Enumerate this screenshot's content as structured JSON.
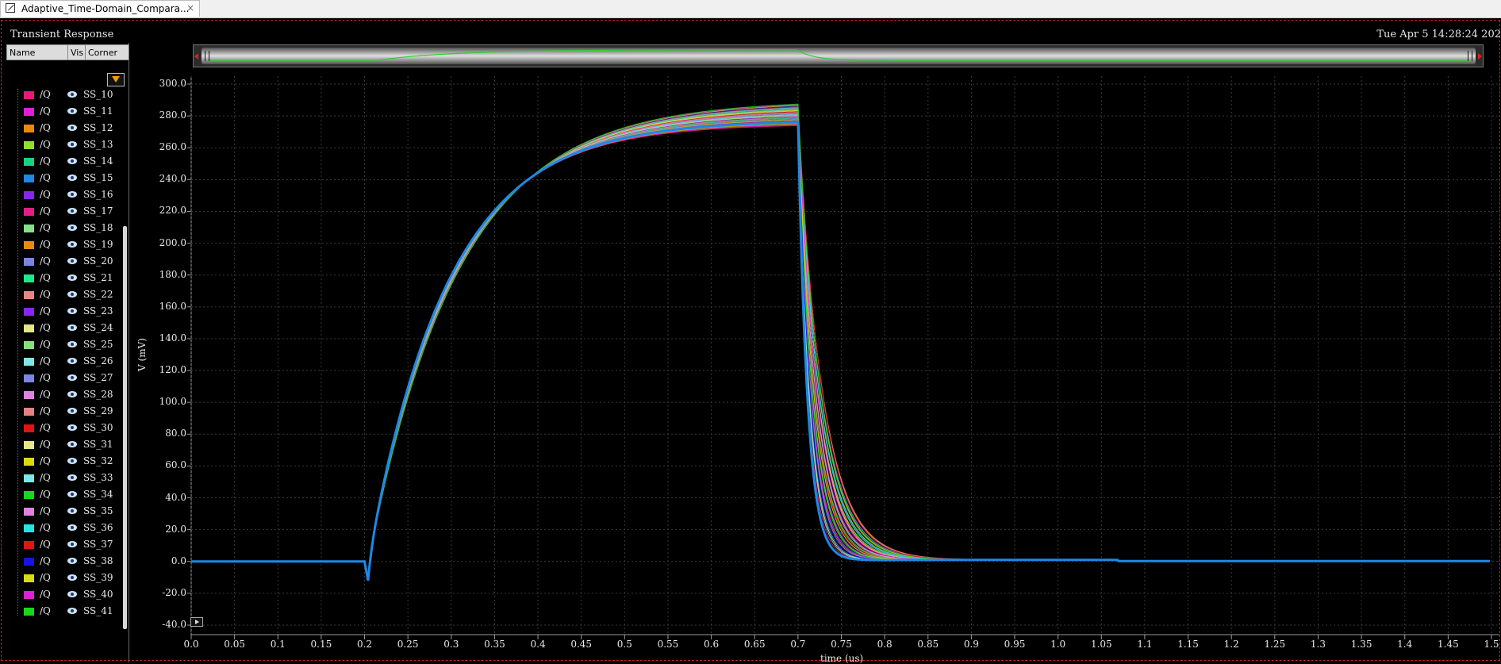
{
  "tab": {
    "title": "Adaptive_Time-Domain_Compara...",
    "close": "×"
  },
  "window": {
    "title": "Transient Response",
    "date": "Tue Apr 5 14:28:24 202"
  },
  "legend": {
    "headers": {
      "name": "Name",
      "vis": "Vis",
      "corner": "Corner"
    },
    "items": [
      {
        "signal": "/Q",
        "corner": "SS_10",
        "color": "#e6197a"
      },
      {
        "signal": "/Q",
        "corner": "SS_11",
        "color": "#e01ed6"
      },
      {
        "signal": "/Q",
        "corner": "SS_12",
        "color": "#e98a0e"
      },
      {
        "signal": "/Q",
        "corner": "SS_13",
        "color": "#8ee02a"
      },
      {
        "signal": "/Q",
        "corner": "SS_14",
        "color": "#17d27f"
      },
      {
        "signal": "/Q",
        "corner": "SS_15",
        "color": "#1e88e5"
      },
      {
        "signal": "/Q",
        "corner": "SS_16",
        "color": "#8a24f0"
      },
      {
        "signal": "/Q",
        "corner": "SS_17",
        "color": "#e01f86"
      },
      {
        "signal": "/Q",
        "corner": "SS_18",
        "color": "#86e08a"
      },
      {
        "signal": "/Q",
        "corner": "SS_19",
        "color": "#e88a12"
      },
      {
        "signal": "/Q",
        "corner": "SS_20",
        "color": "#7b83e8"
      },
      {
        "signal": "/Q",
        "corner": "SS_21",
        "color": "#1ee68c"
      },
      {
        "signal": "/Q",
        "corner": "SS_22",
        "color": "#e98484"
      },
      {
        "signal": "/Q",
        "corner": "SS_23",
        "color": "#8a24f0"
      },
      {
        "signal": "/Q",
        "corner": "SS_24",
        "color": "#e4e48a"
      },
      {
        "signal": "/Q",
        "corner": "SS_25",
        "color": "#86e07a"
      },
      {
        "signal": "/Q",
        "corner": "SS_26",
        "color": "#7fe6e6"
      },
      {
        "signal": "/Q",
        "corner": "SS_27",
        "color": "#7b86e0"
      },
      {
        "signal": "/Q",
        "corner": "SS_28",
        "color": "#e082e0"
      },
      {
        "signal": "/Q",
        "corner": "SS_29",
        "color": "#e68080"
      },
      {
        "signal": "/Q",
        "corner": "SS_30",
        "color": "#e01414"
      },
      {
        "signal": "/Q",
        "corner": "SS_31",
        "color": "#e4e48a"
      },
      {
        "signal": "/Q",
        "corner": "SS_32",
        "color": "#dada14"
      },
      {
        "signal": "/Q",
        "corner": "SS_33",
        "color": "#7fe6e6"
      },
      {
        "signal": "/Q",
        "corner": "SS_34",
        "color": "#18d818"
      },
      {
        "signal": "/Q",
        "corner": "SS_35",
        "color": "#e082e0"
      },
      {
        "signal": "/Q",
        "corner": "SS_36",
        "color": "#1ee6e0"
      },
      {
        "signal": "/Q",
        "corner": "SS_37",
        "color": "#e01414"
      },
      {
        "signal": "/Q",
        "corner": "SS_38",
        "color": "#1414e6"
      },
      {
        "signal": "/Q",
        "corner": "SS_39",
        "color": "#dada14"
      },
      {
        "signal": "/Q",
        "corner": "SS_40",
        "color": "#e01ed6"
      },
      {
        "signal": "/Q",
        "corner": "SS_41",
        "color": "#18d818"
      }
    ]
  },
  "chart_data": {
    "type": "line",
    "title": "Transient Response",
    "xlabel": "time (us)",
    "ylabel": "V (mV)",
    "xlim": [
      0.0,
      1.5
    ],
    "ylim": [
      -40.0,
      300.0
    ],
    "grid": true,
    "xticks": [
      "0.0",
      "0.05",
      "0.1",
      "0.15",
      "0.2",
      "0.25",
      "0.3",
      "0.35",
      "0.4",
      "0.45",
      "0.5",
      "0.55",
      "0.6",
      "0.65",
      "0.7",
      "0.75",
      "0.8",
      "0.85",
      "0.9",
      "0.95",
      "1.0",
      "1.05",
      "1.1",
      "1.15",
      "1.2",
      "1.25",
      "1.3",
      "1.35",
      "1.4",
      "1.45",
      "1.5"
    ],
    "yticks": [
      "300.0",
      "280.0",
      "260.0",
      "240.0",
      "220.0",
      "200.0",
      "180.0",
      "160.0",
      "140.0",
      "120.0",
      "100.0",
      "80.0",
      "60.0",
      "40.0",
      "20.0",
      "0.0",
      "-20.0",
      "-40.0"
    ],
    "series_shape": {
      "baseline": 0.0,
      "step_time": 0.2,
      "undershoot": -12.0,
      "fall_time": 0.7,
      "settle_time": 0.8,
      "peak_min": 255.0,
      "peak_max": 270.0
    },
    "highlight_series": "SS_15",
    "highlight_color": "#1e88e5"
  }
}
